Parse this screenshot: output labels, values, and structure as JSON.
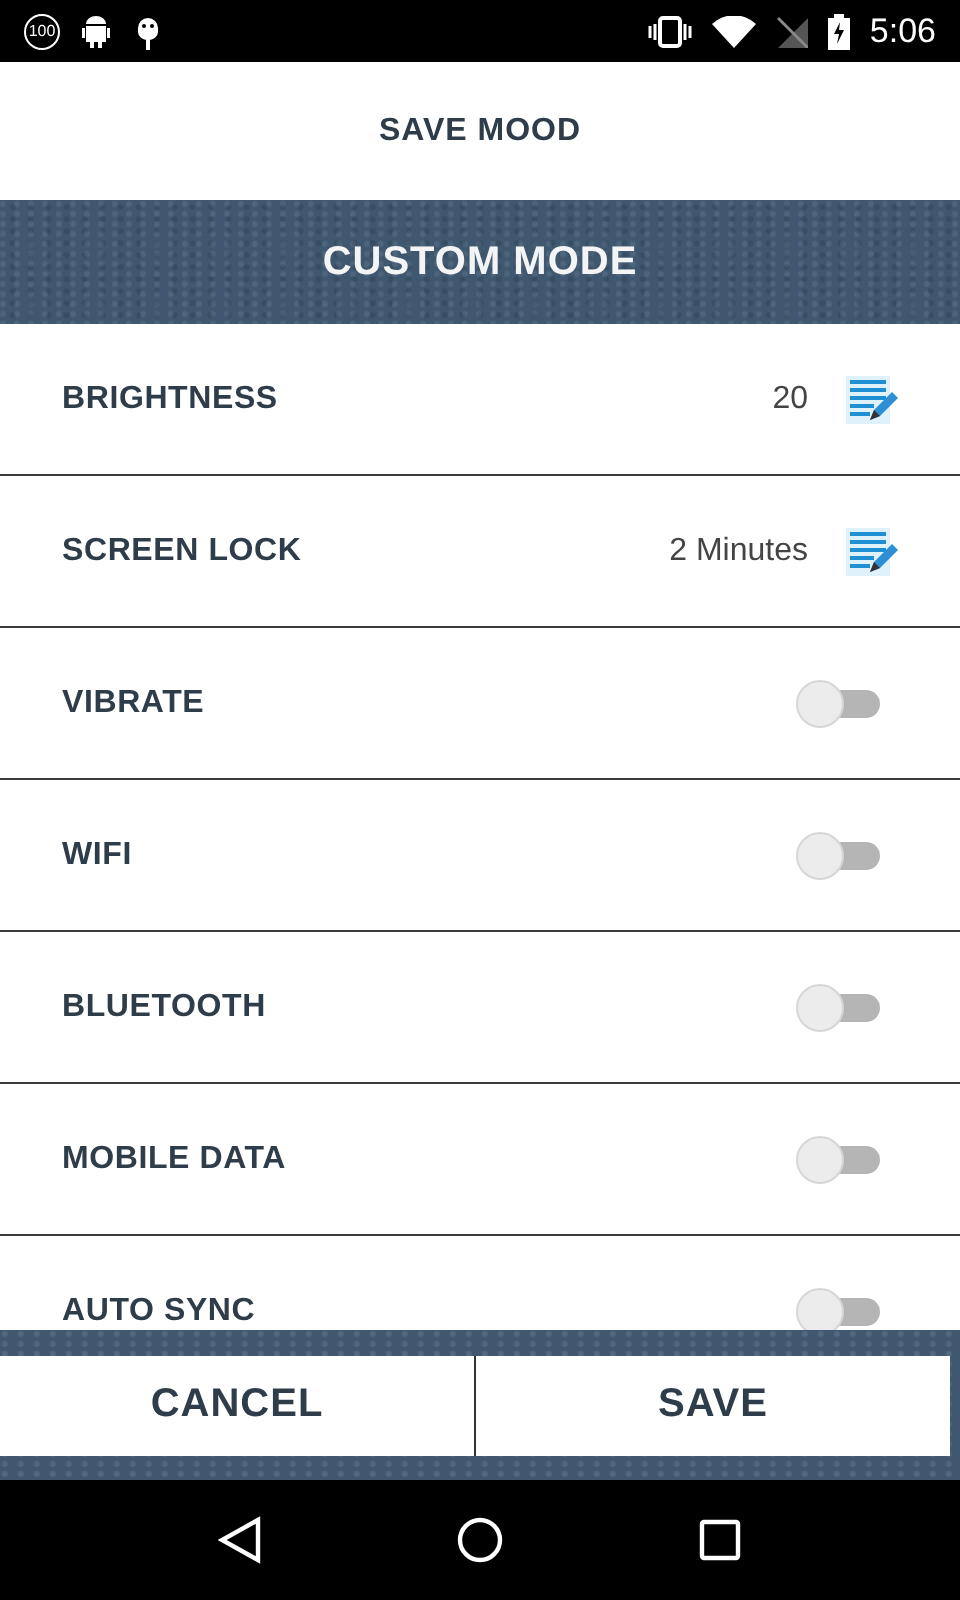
{
  "status_bar": {
    "time": "5:06",
    "battery_badge": "100"
  },
  "title": "SAVE MOOD",
  "header": "CUSTOM MODE",
  "settings": [
    {
      "kind": "value",
      "label": "BRIGHTNESS",
      "value": "20"
    },
    {
      "kind": "value",
      "label": "SCREEN LOCK",
      "value": "2 Minutes"
    },
    {
      "kind": "toggle",
      "label": "VIBRATE",
      "on": false
    },
    {
      "kind": "toggle",
      "label": "WIFI",
      "on": false
    },
    {
      "kind": "toggle",
      "label": "BLUETOOTH",
      "on": false
    },
    {
      "kind": "toggle",
      "label": "MOBILE DATA",
      "on": false
    },
    {
      "kind": "toggle",
      "label": "AUTO SYNC",
      "on": false
    }
  ],
  "buttons": [
    "CANCEL",
    "SAVE"
  ]
}
